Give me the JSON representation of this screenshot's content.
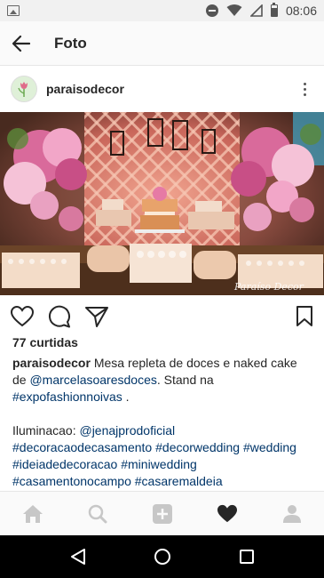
{
  "status_bar": {
    "time": "08:06",
    "icons": [
      "gallery-icon",
      "do-not-disturb-icon",
      "wifi-icon",
      "no-signal-icon",
      "battery-icon"
    ]
  },
  "app_bar": {
    "title": "Foto",
    "back_icon": "arrow-left-icon"
  },
  "post": {
    "username": "paraisodecor",
    "avatar_icon": "tulip-logo",
    "more_icon": "vertical-dots-icon",
    "photo": {
      "watermark": "Paraíso Decor"
    },
    "actions": [
      "heart-icon",
      "comment-icon",
      "share-icon",
      "bookmark-icon"
    ],
    "likes": "77 curtidas",
    "caption": {
      "user": "paraisodecor",
      "text1": " Mesa repleta de doces e naked cake de ",
      "mention1": "@marcelasoaresdoces",
      "text2": ". Stand na ",
      "hashtag1": "#expofashionnoivas",
      "text3": " .",
      "illumination_label": "Iluminacao: ",
      "mention2": "@jenajprodoficial",
      "hashtags": [
        "#decoracaodecasamento",
        "#decorwedding",
        "#wedding",
        "#ideiadedecoracao",
        "#miniwedding",
        "#casamentonocampo",
        "#casaremaldeia"
      ]
    }
  },
  "bottom_nav": [
    "home-icon",
    "search-icon",
    "add-icon",
    "activity-heart-icon",
    "profile-icon"
  ],
  "system_nav": [
    "back-triangle-icon",
    "home-circle-icon",
    "recents-square-icon"
  ],
  "colors": {
    "link": "#003569",
    "text": "#262626",
    "bar_bg": "#fafafa"
  }
}
